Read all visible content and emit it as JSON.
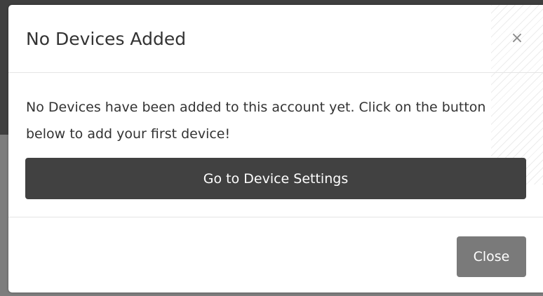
{
  "modal": {
    "title": "No Devices Added",
    "close_symbol": "×",
    "message": "No Devices have been added to this account yet. Click on the button below to add your first device!",
    "primary_button_label": "Go to Device Settings",
    "footer_button_label": "Close"
  },
  "icons": {
    "close": "close-icon",
    "background_partial": "partial-numeral-icon"
  },
  "colors": {
    "overlay_dark": "#3f3f3f",
    "overlay_light": "#7d7d7d",
    "primary_button": "#414141",
    "secondary_button": "#7a7a7a",
    "title_text": "#333333",
    "close_icon": "#8a8a8a"
  }
}
